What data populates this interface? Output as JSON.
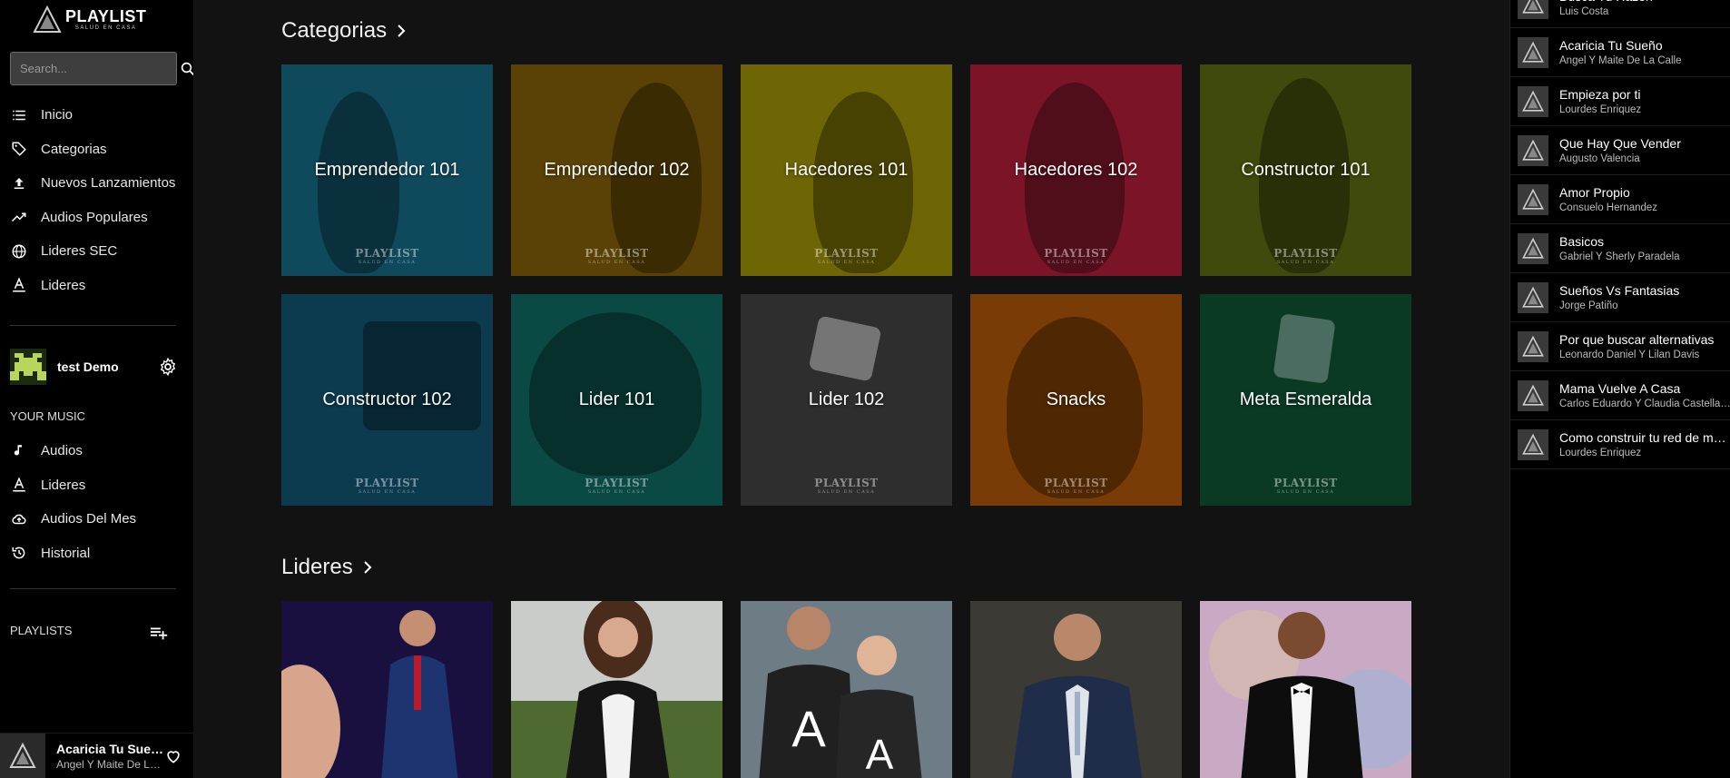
{
  "brand": {
    "name": "PLAYLIST",
    "tagline": "SALUD EN CASA"
  },
  "search": {
    "placeholder": "Search..."
  },
  "nav": [
    {
      "label": "Inicio",
      "icon": "list-icon"
    },
    {
      "label": "Categorias",
      "icon": "tag-icon"
    },
    {
      "label": "Nuevos Lanzamientos",
      "icon": "upload-icon"
    },
    {
      "label": "Audios Populares",
      "icon": "trending-icon"
    },
    {
      "label": "Lideres SEC",
      "icon": "globe-icon"
    },
    {
      "label": "Lideres",
      "icon": "letter-a-icon"
    }
  ],
  "user": {
    "name": "test Demo"
  },
  "your_music": {
    "label": "YOUR MUSIC",
    "items": [
      {
        "label": "Audios",
        "icon": "music-note-icon"
      },
      {
        "label": "Lideres",
        "icon": "letter-a-icon"
      },
      {
        "label": "Audios Del Mes",
        "icon": "cloud-upload-icon"
      },
      {
        "label": "Historial",
        "icon": "history-icon"
      }
    ]
  },
  "playlists": {
    "label": "PLAYLISTS"
  },
  "now_playing": {
    "title": "Acaricia Tu Sueño",
    "artist": "Angel Y Maite De La Calle"
  },
  "categories": {
    "title": "Categorias",
    "items": [
      {
        "label": "Emprendedor 101",
        "color": "#0f4a5c"
      },
      {
        "label": "Emprendedor 102",
        "color": "#5a4206"
      },
      {
        "label": "Hacedores 101",
        "color": "#6e6504"
      },
      {
        "label": "Hacedores 102",
        "color": "#7c1428"
      },
      {
        "label": "Constructor 101",
        "color": "#3f4a0c"
      },
      {
        "label": "Constructor 102",
        "color": "#0c3a4e"
      },
      {
        "label": "Lider 101",
        "color": "#0b4a44"
      },
      {
        "label": "Lider 102",
        "color": "#2e2e2e"
      },
      {
        "label": "Snacks",
        "color": "#7a3c06"
      },
      {
        "label": "Meta Esmeralda",
        "color": "#0b3a24"
      }
    ]
  },
  "leaders": {
    "title": "Lideres",
    "items": [
      {
        "bg": "#1a1040"
      },
      {
        "bg": "#c9ccc8"
      },
      {
        "bg": "#6e7c86"
      },
      {
        "bg": "#3b3a34"
      },
      {
        "bg": "#c9a9c4"
      }
    ]
  },
  "queue": [
    {
      "title": "Busca Tu Razon",
      "artist": "Luis Costa"
    },
    {
      "title": "Acaricia Tu Sueño",
      "artist": "Angel Y Maite De La Calle"
    },
    {
      "title": "Empieza por ti",
      "artist": "Lourdes Enriquez"
    },
    {
      "title": "Que Hay Que Vender",
      "artist": "Augusto Valencia"
    },
    {
      "title": "Amor Propio",
      "artist": "Consuelo Hernandez"
    },
    {
      "title": "Basicos",
      "artist": "Gabriel Y Sherly Paradela"
    },
    {
      "title": "Sueños Vs Fantasias",
      "artist": "Jorge Patiño"
    },
    {
      "title": "Por que buscar alternativas",
      "artist": "Leonardo Daniel Y Lilan Davis"
    },
    {
      "title": "Mama Vuelve A Casa",
      "artist": "Carlos Eduardo Y Claudia Castellanos"
    },
    {
      "title": "Como construir tu red de mercadeo",
      "artist": "Lourdes Enriquez"
    }
  ]
}
